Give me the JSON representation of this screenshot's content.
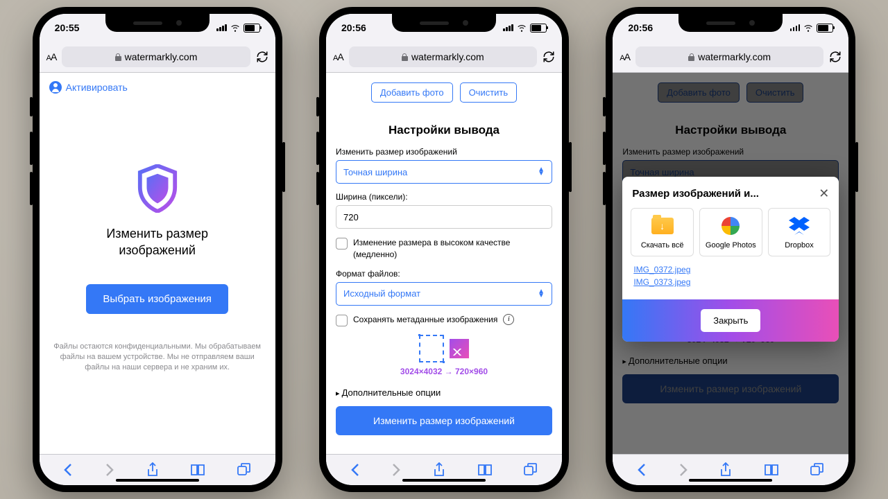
{
  "phones": [
    {
      "time": "20:55"
    },
    {
      "time": "20:56"
    },
    {
      "time": "20:56"
    }
  ],
  "url_domain": "watermarkly.com",
  "activate_label": "Активировать",
  "p1": {
    "title_l1": "Изменить размер",
    "title_l2": "изображений",
    "select_btn": "Выбрать изображения",
    "disclaimer": "Файлы остаются конфиденциальными. Мы обрабатываем файлы на вашем устройстве. Мы не отправляем ваши файлы на наши сервера и не храним их."
  },
  "p2": {
    "add_photo": "Добавить фото",
    "clear": "Очистить",
    "heading": "Настройки вывода",
    "resize_label": "Изменить размер изображений",
    "resize_mode": "Точная ширина",
    "width_label": "Ширина (пиксели):",
    "width_value": "720",
    "hq_label": "Изменение размера в высоком качестве (медленно)",
    "format_label": "Формат файлов:",
    "format_value": "Исходный формат",
    "meta_label": "Сохранять метаданные изображения",
    "dims_text": "3024×4032 → 720×960",
    "advanced": "Дополнительные опции",
    "go_btn": "Изменить размер изображений"
  },
  "modal": {
    "title": "Размер изображений и...",
    "download_all": "Скачать всё",
    "gphotos": "Google Photos",
    "dropbox": "Dropbox",
    "files": [
      "IMG_0372.jpeg",
      "IMG_0373.jpeg"
    ],
    "close": "Закрыть"
  }
}
